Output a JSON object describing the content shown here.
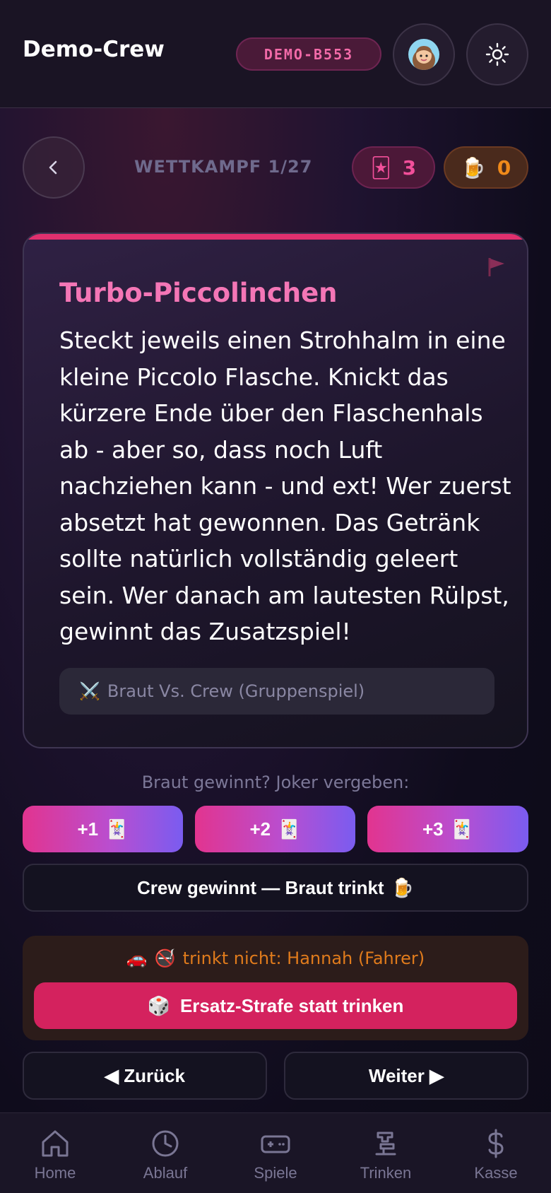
{
  "header": {
    "title": "Demo-Crew",
    "code": "DEMO-B553",
    "avatar_icon": "avatar-icon",
    "theme_icon": "sun-icon"
  },
  "progress": {
    "label": "WETTKAMPF 1/27",
    "joker_count": "3",
    "beer_count": "0"
  },
  "card": {
    "title": "Turbo-Piccolinchen",
    "text": "Steckt jeweils einen Strohhalm in eine kleine Piccolo Flasche. Knickt das kürzere Ende über den Flaschenhals ab - aber so, dass noch Luft nachziehen kann - und ext! Wer zuerst absetzt hat gewonnen. Das Getränk sollte natürlich vollständig geleert sein. Wer danach am lautesten Rülpst, gewinnt das Zusatzspiel!",
    "tag": "Braut Vs. Crew (Gruppenspiel)",
    "accent_color": "#e0306e"
  },
  "actions": {
    "joker_prompt": "Braut gewinnt? Joker vergeben:",
    "joker_buttons": [
      "+1",
      "+2",
      "+3"
    ],
    "crew_wins": "Crew gewinnt — Braut trinkt",
    "driver_note": "trinkt nicht: Hannah (Fahrer)",
    "penalty_button": "Ersatz-Strafe statt trinken",
    "back": "◀ Zurück",
    "next": "Weiter ▶"
  },
  "nav": {
    "items": [
      {
        "label": "Home",
        "icon": "home-icon"
      },
      {
        "label": "Ablauf",
        "icon": "clock-icon"
      },
      {
        "label": "Spiele",
        "icon": "gamepad-icon"
      },
      {
        "label": "Trinken",
        "icon": "beer-tap-icon"
      },
      {
        "label": "Kasse",
        "icon": "dollar-icon"
      }
    ]
  },
  "colors": {
    "primary_pink": "#e0306e",
    "joker_pink": "#f24f9a",
    "beer_orange": "#f08a1a"
  }
}
